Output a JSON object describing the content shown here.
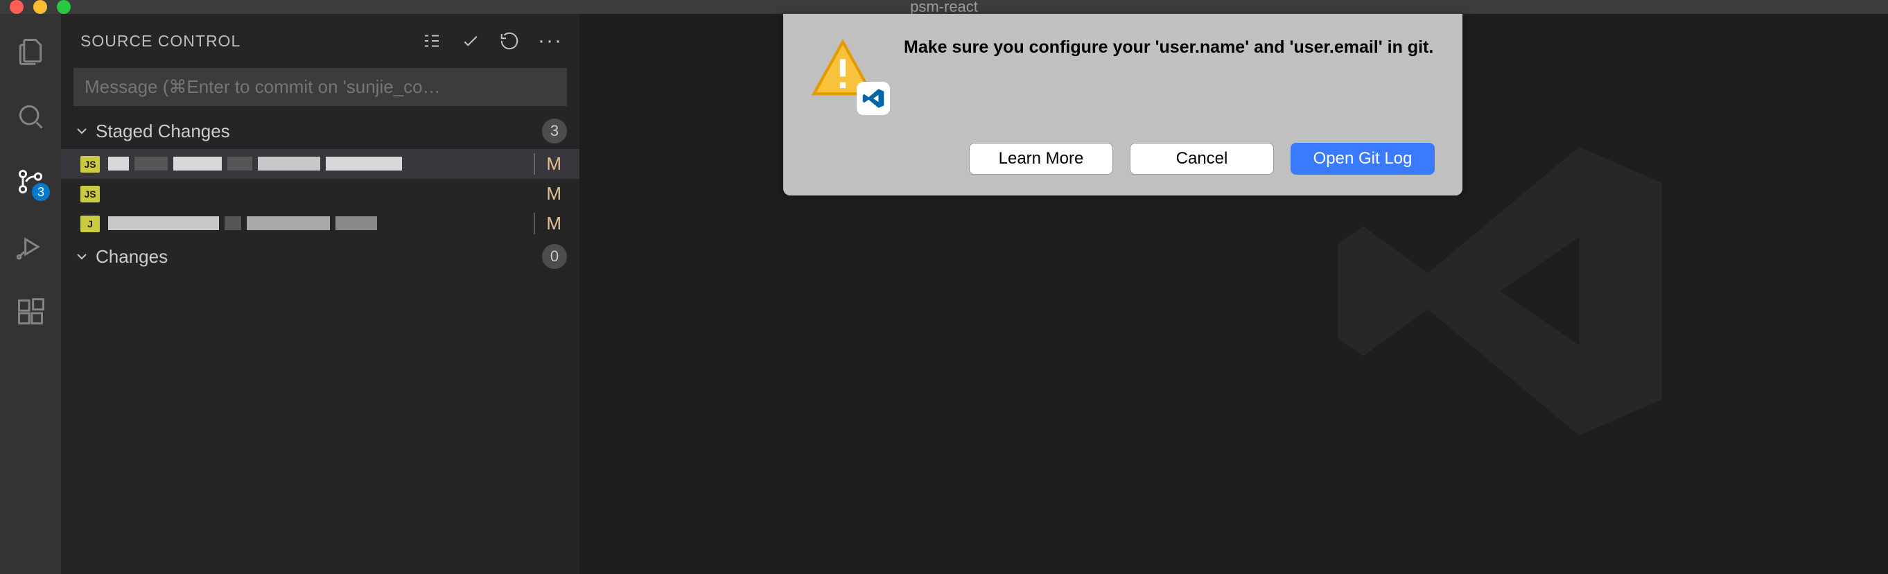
{
  "window": {
    "title": "psm-react"
  },
  "activityBar": {
    "scmBadge": "3"
  },
  "sidebar": {
    "title": "SOURCE CONTROL",
    "commitPlaceholder": "Message (⌘Enter to commit on 'sunjie_co…",
    "staged": {
      "label": "Staged Changes",
      "count": "3",
      "files": [
        {
          "iconText": "JS",
          "status": "M"
        },
        {
          "iconText": "JS",
          "status": "M"
        },
        {
          "iconText": "J",
          "status": "M"
        }
      ]
    },
    "changes": {
      "label": "Changes",
      "count": "0"
    }
  },
  "dialog": {
    "message": "Make sure you configure your 'user.name' and 'user.email' in git.",
    "buttons": {
      "learnMore": "Learn More",
      "cancel": "Cancel",
      "openGitLog": "Open Git Log"
    }
  }
}
